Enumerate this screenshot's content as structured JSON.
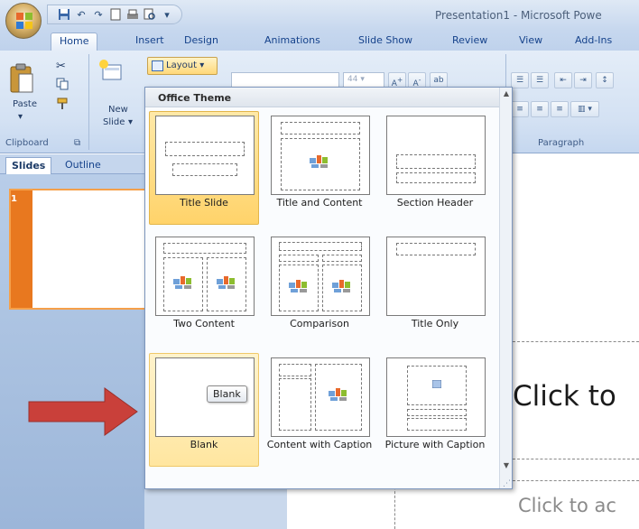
{
  "window": {
    "title": "Presentation1 - Microsoft Powe"
  },
  "quick_access": {
    "items": [
      "save-icon",
      "undo-icon",
      "redo-icon",
      "new-icon",
      "print-icon",
      "print-preview-icon",
      "customize-dropdown-icon"
    ]
  },
  "ribbon_tabs": [
    "Home",
    "Insert",
    "Design",
    "Animations",
    "Slide Show",
    "Review",
    "View",
    "Add-Ins"
  ],
  "ribbon": {
    "paste_label": "Paste",
    "new_slide_label_1": "New",
    "new_slide_label_2": "Slide",
    "layout_label": "Layout",
    "font_size_value": "44",
    "groups": {
      "clipboard": "Clipboard",
      "paragraph": "Paragraph"
    }
  },
  "left_pane": {
    "tabs": [
      "Slides",
      "Outline"
    ],
    "slide_number": "1"
  },
  "slide": {
    "title_placeholder": "Click to",
    "subtitle_placeholder": "Click to ac"
  },
  "gallery": {
    "header": "Office Theme",
    "layouts": [
      {
        "label": "Title Slide",
        "state": "selected"
      },
      {
        "label": "Title and Content",
        "state": "normal"
      },
      {
        "label": "Section Header",
        "state": "normal"
      },
      {
        "label": "Two Content",
        "state": "normal"
      },
      {
        "label": "Comparison",
        "state": "normal"
      },
      {
        "label": "Title Only",
        "state": "normal"
      },
      {
        "label": "Blank",
        "state": "hovered"
      },
      {
        "label": "Content with Caption",
        "state": "normal"
      },
      {
        "label": "Picture with Caption",
        "state": "normal"
      }
    ],
    "tooltip": "Blank"
  },
  "colors": {
    "ribbon_blue": "#15428b",
    "selection_gold": "#ffd36a",
    "arrow_red": "#c0392b"
  }
}
